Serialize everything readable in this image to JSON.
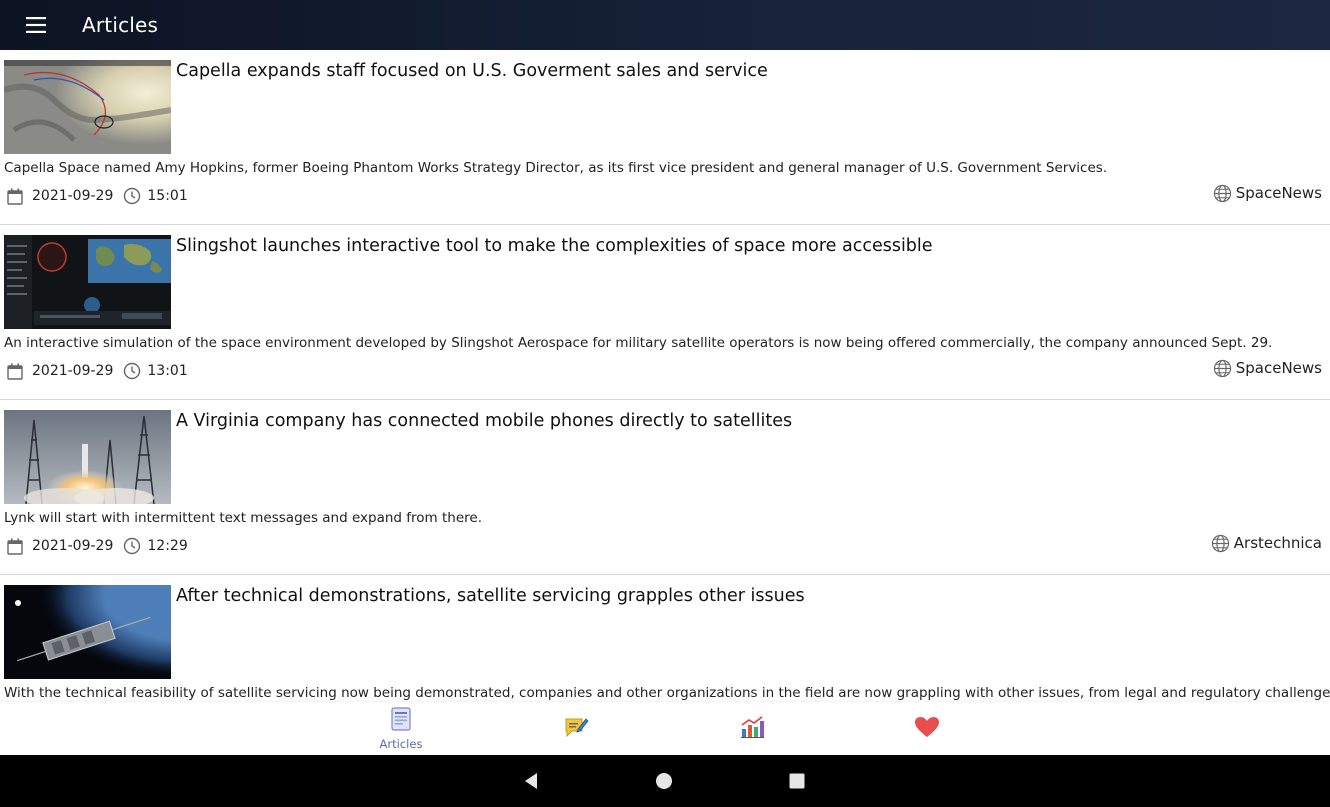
{
  "app_bar": {
    "title": "Articles",
    "menu_icon": "hamburger-menu-icon"
  },
  "articles": [
    {
      "title": "Capella expands staff focused on U.S. Goverment sales and service",
      "summary": "Capella Space named Amy Hopkins, former Boeing Phantom Works Strategy Director, as its first vice president and general manager of U.S. Government Services.",
      "date": "2021-09-29",
      "time": "15:01",
      "source": "SpaceNews"
    },
    {
      "title": "Slingshot launches interactive tool to make the complexities of space more accessible",
      "summary": "An interactive simulation of the space environment developed by Slingshot Aerospace for military satellite operators is now being offered commercially, the company announced Sept. 29.",
      "date": "2021-09-29",
      "time": "13:01",
      "source": "SpaceNews"
    },
    {
      "title": "A Virginia company has connected mobile phones directly to satellites",
      "summary": "Lynk will start with intermittent text messages and expand from there.",
      "date": "2021-09-29",
      "time": "12:29",
      "source": "Arstechnica"
    },
    {
      "title": "After technical demonstrations, satellite servicing grapples other issues",
      "summary": "With the technical feasibility of satellite servicing now being demonstrated, companies and other organizations in the field are now grappling with other issues, from legal and regulatory challenges to the development of"
    }
  ],
  "bottom_nav": {
    "items": [
      {
        "label": "Articles",
        "icon": "articles-icon",
        "active": true
      },
      {
        "label": "",
        "icon": "blog-icon"
      },
      {
        "label": "",
        "icon": "reports-chart-icon"
      },
      {
        "label": "",
        "icon": "favorites-heart-icon"
      }
    ],
    "active_color": "#5a6aa8"
  },
  "system_nav": {
    "back_icon": "back-triangle-icon",
    "home_icon": "home-circle-icon",
    "recents_icon": "recents-square-icon"
  }
}
